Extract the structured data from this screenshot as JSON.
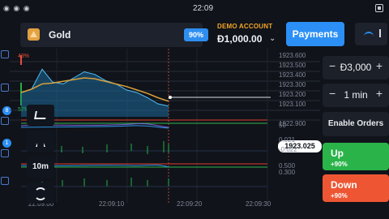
{
  "status": {
    "left": "◉ ◉ ◉",
    "time": "22:09"
  },
  "asset": {
    "name": "Gold",
    "payout": "90%"
  },
  "account": {
    "type": "DEMO ACCOUNT",
    "balance": "Đ1,000.00"
  },
  "header": {
    "payments_label": "Payments"
  },
  "chart": {
    "price_label": "1923.025",
    "y_ticks": [
      "1923.600",
      "1923.500",
      "1923.400",
      "1923.300",
      "1923.200",
      "1923.100",
      "1922.900"
    ],
    "sub1_ticks": [
      "50"
    ],
    "sub2_ticks": [
      "0.021",
      "-0.022"
    ],
    "sub3_ticks": [
      "0.500",
      "0.300"
    ],
    "x_ticks": [
      "22:09:00",
      "22:09:10",
      "22:09:20",
      "22:09:30"
    ],
    "pct_top": "43%",
    "pct_bottom": "57%"
  },
  "chart_data": {
    "type": "area",
    "title": "",
    "xlabel": "",
    "ylabel": "",
    "ylim": [
      1922.9,
      1923.65
    ],
    "x": [
      "22:09:00",
      "22:09:10",
      "22:09:20",
      "22:09:30"
    ],
    "series": [
      {
        "values": [
          1923.18,
          1923.22,
          1923.45,
          1923.3,
          1923.28,
          1923.35,
          1923.42,
          1923.39,
          1923.32,
          1923.28,
          1923.21,
          1923.18,
          1923.12,
          1923.05,
          1923.025
        ]
      },
      {
        "values": [
          1923.18,
          1923.22,
          1923.28,
          1923.29,
          1923.31,
          1923.33,
          1923.35,
          1923.34,
          1923.31,
          1923.28,
          1923.25,
          1923.21,
          1923.17,
          1923.12,
          1923.08
        ]
      }
    ]
  },
  "overlay": {
    "timeframe": "10m"
  },
  "trade": {
    "amount": "Đ3,000",
    "minus": "−",
    "plus": "+",
    "time": "1 min",
    "enable_orders": "Enable Orders",
    "up_label": "Up",
    "up_payout": "+90%",
    "down_label": "Down",
    "down_payout": "+90%"
  },
  "colors": {
    "accent": "#2b8ff6",
    "up": "#2ab349",
    "down": "#ee5633",
    "demo": "#f2a627"
  },
  "icons": {
    "asset": "gold-icon",
    "expand": "expand-icon",
    "draw": "draw-icon",
    "signal": "signal-icon"
  }
}
